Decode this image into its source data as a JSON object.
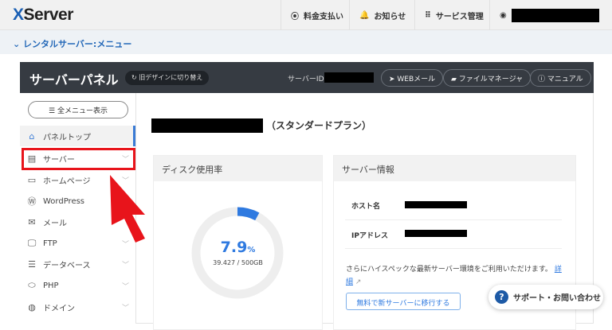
{
  "header": {
    "logo_x": "X",
    "logo_rest": "Server",
    "nav": [
      {
        "icon": "yen-icon",
        "label": "料金支払い"
      },
      {
        "icon": "bell-icon",
        "label": "お知らせ"
      },
      {
        "icon": "grid-icon",
        "label": "サービス管理"
      }
    ]
  },
  "breadcrumb": {
    "label": "レンタルサーバー:メニュー"
  },
  "panel": {
    "title": "サーバーパネル",
    "old_design": "旧デザインに切り替え",
    "server_id_label": "サーバーID",
    "buttons": [
      "WEBメール",
      "ファイルマネージャ",
      "マニュアル"
    ]
  },
  "sidebar": {
    "all_menu": "全メニュー表示",
    "items": [
      {
        "label": "パネルトップ",
        "icon": "home-icon"
      },
      {
        "label": "サーバー",
        "icon": "server-icon"
      },
      {
        "label": "ホームページ",
        "icon": "browser-icon"
      },
      {
        "label": "WordPress",
        "icon": "wordpress-icon"
      },
      {
        "label": "メール",
        "icon": "mail-icon"
      },
      {
        "label": "FTP",
        "icon": "monitor-icon"
      },
      {
        "label": "データベース",
        "icon": "database-icon"
      },
      {
        "label": "PHP",
        "icon": "php-icon"
      },
      {
        "label": "ドメイン",
        "icon": "globe-icon"
      }
    ]
  },
  "main": {
    "plan": "（スタンダードプラン）",
    "disk": {
      "title": "ディスク使用率",
      "percent": "7.9",
      "unit": "%",
      "usage": "39.427 / 500GB",
      "fraction": 0.079,
      "accent": "#2f7ae0"
    },
    "info": {
      "title": "サーバー情報",
      "host_label": "ホスト名",
      "ip_label": "IPアドレス",
      "note": "さらにハイスペックな最新サーバー環境をご利用いただけます。",
      "detail_link": "詳細",
      "migrate": "無料で新サーバーに移行する"
    }
  },
  "support": {
    "label": "サポート・お問い合わせ"
  }
}
